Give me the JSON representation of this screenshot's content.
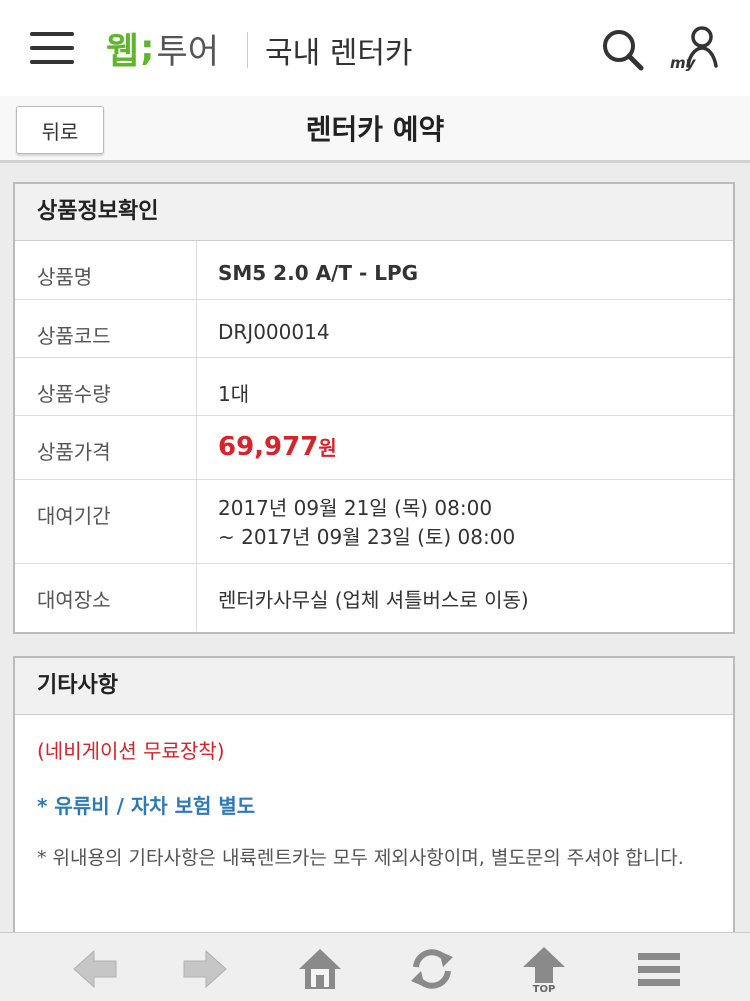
{
  "header": {
    "logo_part1": "웹",
    "logo_part2": ";",
    "logo_part3": "투어",
    "section": "국내 렌터카",
    "icons": {
      "menu": "hamburger-icon",
      "search": "search-icon",
      "my": "my-user-icon"
    },
    "my_label": "my"
  },
  "subbar": {
    "back_label": "뒤로",
    "title": "렌터카 예약"
  },
  "product_info": {
    "heading": "상품정보확인",
    "rows": [
      {
        "label": "상품명",
        "value": "SM5 2.0 A/T - LPG"
      },
      {
        "label": "상품코드",
        "value": "DRJ000014"
      },
      {
        "label": "상품수량",
        "value": "1대"
      },
      {
        "label": "상품가격",
        "price": "69,977",
        "unit": "원"
      },
      {
        "label": "대여기간",
        "line1": "2017년 09월 21일 (목) 08:00",
        "line2": "~ 2017년 09월 23일 (토) 08:00"
      },
      {
        "label": "대여장소",
        "value": "렌터카사무실 (업체 셔틀버스로 이동)"
      }
    ]
  },
  "etc": {
    "heading": "기타사항",
    "note_red": "(네비게이션 무료장착)",
    "note_blue": "* 유류비 / 자차 보험 별도",
    "note_gray": "* 위내용의 기타사항은 내륙렌트카는 모두 제외사항이며, 별도문의 주셔야 합니다."
  },
  "bottom_nav": {
    "top_label": "TOP"
  },
  "colors": {
    "brand_green": "#5fb62b",
    "price_red": "#d8232a",
    "note_blue": "#2e7ab8"
  }
}
